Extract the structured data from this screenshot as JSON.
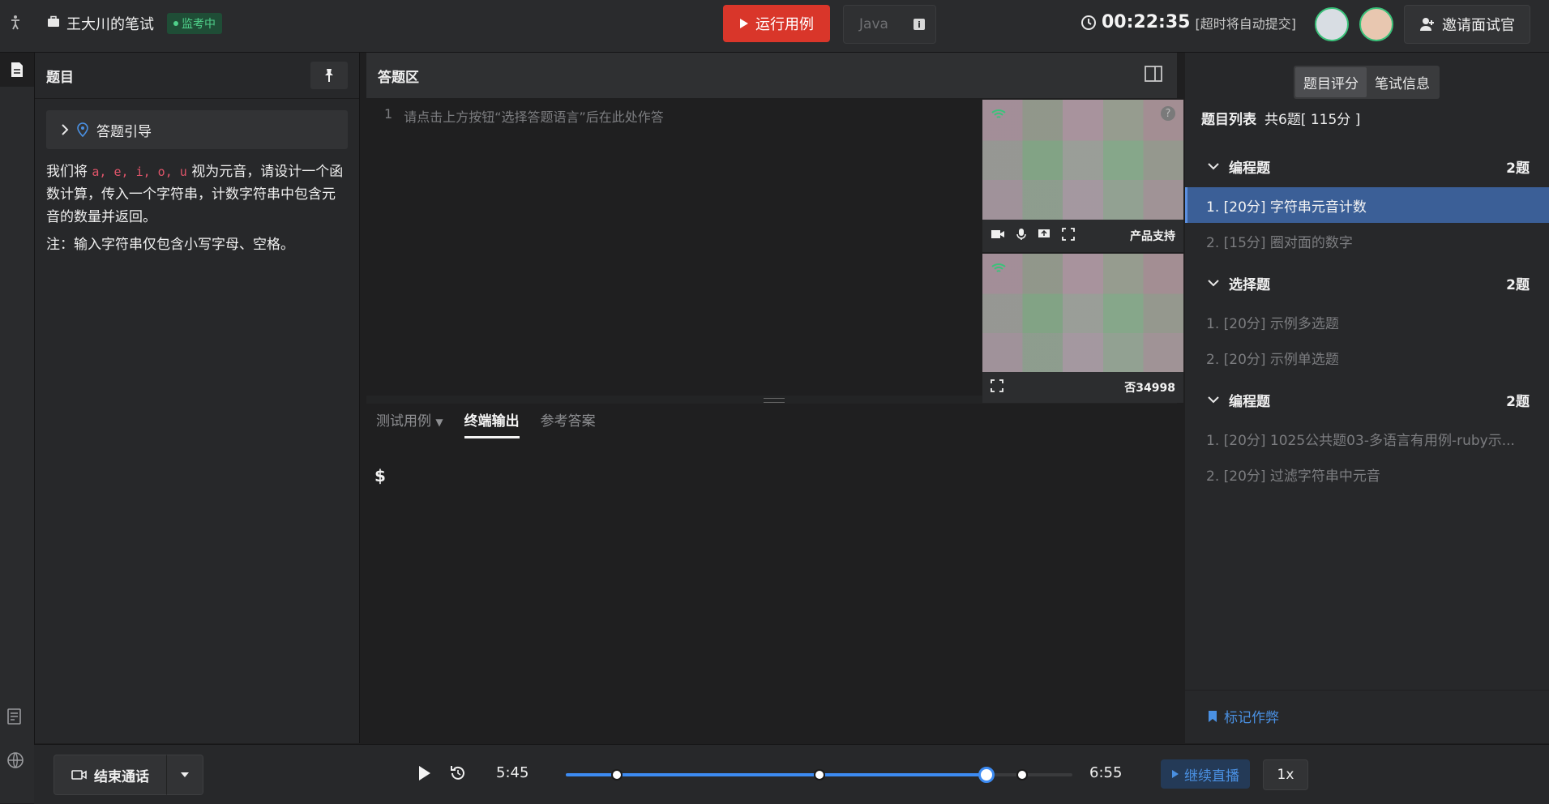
{
  "header": {
    "title": "王大川的笔试",
    "badge": "监考中",
    "run_label": "运行用例",
    "language": "Java",
    "timer": "00:22:35",
    "timer_note": "[超时将自动提交]",
    "invite_label": "邀请面试官"
  },
  "problem": {
    "header": "题目",
    "guide": "答题引导",
    "desc_prefix": "我们将",
    "vowels": "a, e, i, o, u",
    "desc_suffix": "视为元音，请设计一个函数计算，传入一个字符串，计数字符串中包含元音的数量并返回。",
    "note": "注：输入字符串仅包含小写字母、空格。"
  },
  "answer": {
    "header": "答题区",
    "line_no": "1",
    "placeholder": "请点击上方按钮“选择答题语言”后在此处作答",
    "tabs": [
      "测试用例",
      "终端输出",
      "参考答案"
    ],
    "active_tab": "终端输出",
    "prompt": "$"
  },
  "video": {
    "tile1_label": "产品支持",
    "tile2_label": "否34998",
    "help": "?"
  },
  "right": {
    "seg": [
      "题目评分",
      "笔试信息"
    ],
    "list_title": "题目列表",
    "list_summary": "共6题[ 115分 ]",
    "sections": [
      {
        "name": "编程题",
        "count": "2题",
        "items": [
          "1. [20分] 字符串元音计数",
          "2. [15分] 圈对面的数字"
        ]
      },
      {
        "name": "选择题",
        "count": "2题",
        "items": [
          "1. [20分] 示例多选题",
          "2. [20分] 示例单选题"
        ]
      },
      {
        "name": "编程题",
        "count": "2题",
        "items": [
          "1. [20分] 1025公共题03-多语言有用例-ruby示...",
          "2. [20分] 过滤字符串中元音"
        ]
      }
    ],
    "mark_label": "标记作弊"
  },
  "bottom": {
    "end_call": "结束通话",
    "current_time": "5:45",
    "end_time": "6:55",
    "progress": 0.83,
    "markers": [
      0.1,
      0.5,
      0.83,
      0.9
    ],
    "live_label": "继续直播",
    "speed": "1x"
  }
}
